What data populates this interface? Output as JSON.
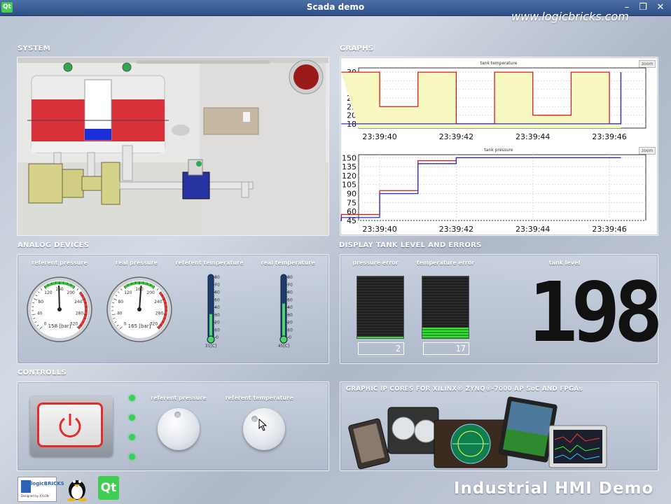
{
  "window": {
    "title": "Scada demo",
    "minimize_glyph": "–",
    "maximize_glyph": "❐",
    "close_glyph": "✕",
    "app_icon_label": "Qt"
  },
  "watermark": "www.logicbricks.com",
  "sections": {
    "system": "SYSTEM",
    "graphs": "GRAPHS",
    "analog": "ANALOG DEVICES",
    "display": "DISPLAY TANK LEVEL AND ERRORS",
    "controls": "CONTROLLS",
    "promo": "GRAPHIC IP CORES FOR XILINX® ZYNQ®-7000 AP SoC AND FPGAs"
  },
  "graphs": {
    "zoom_label": "zoom",
    "temperature": {
      "title": "tank temperature",
      "yticks": [
        "30",
        "28",
        "26",
        "24",
        "22",
        "20",
        "18"
      ],
      "xticks": [
        "23:39:40",
        "23:39:42",
        "23:39:44",
        "23:39:46"
      ]
    },
    "pressure": {
      "title": "tank pressure",
      "yticks": [
        "150",
        "135",
        "120",
        "105",
        "90",
        "75",
        "60",
        "45"
      ],
      "xticks": [
        "23:39:40",
        "23:39:42",
        "23:39:44",
        "23:39:46"
      ]
    }
  },
  "chart_data": [
    {
      "type": "line",
      "title": "tank temperature",
      "ylim": [
        17,
        31
      ],
      "x": [
        "23:39:39",
        "23:39:40",
        "23:39:41",
        "23:39:42",
        "23:39:43",
        "23:39:44",
        "23:39:45",
        "23:39:46",
        "23:39:46.3"
      ],
      "series": [
        {
          "values": [
            30,
            22,
            30,
            18,
            30,
            20,
            30,
            18,
            30
          ],
          "color": "#d02020"
        },
        {
          "values": [
            18,
            18,
            18,
            18,
            18,
            18,
            18,
            18,
            30
          ],
          "color": "#3030c0"
        }
      ],
      "fill_color": "#f7f7c0"
    },
    {
      "type": "line",
      "title": "tank pressure",
      "ylim": [
        45,
        155
      ],
      "x": [
        "23:39:38.6",
        "23:39:39",
        "23:39:40",
        "23:39:41",
        "23:39:42",
        "23:39:43",
        "23:39:44",
        "23:39:45",
        "23:39:46.3"
      ],
      "series": [
        {
          "values": [
            45,
            55,
            95,
            145,
            150,
            150,
            150,
            150,
            150
          ],
          "color": "#d02020"
        },
        {
          "values": [
            45,
            50,
            90,
            140,
            150,
            150,
            150,
            150,
            150
          ],
          "color": "#3030c0"
        }
      ]
    }
  ],
  "analog": {
    "referent_pressure": {
      "label": "referent pressure",
      "value": 158,
      "readout": "158 [bar]"
    },
    "real_pressure": {
      "label": "real pressure",
      "value": 165,
      "readout": "165 [bar]"
    },
    "referent_temperature": {
      "label": "referent  temperature",
      "value": 31,
      "readout": "31[C]"
    },
    "real_temperature": {
      "label": "real temperature",
      "value": 45,
      "readout": "45[C]"
    },
    "gauge_ticks": [
      "0",
      "40",
      "80",
      "120",
      "160",
      "200",
      "240",
      "280",
      "320"
    ],
    "thermo_ticks": [
      "80",
      "70",
      "60",
      "50",
      "40",
      "30",
      "20",
      "10",
      "0"
    ]
  },
  "display": {
    "pressure_error": {
      "label": "pressure error",
      "value": "2",
      "level": 0.02
    },
    "temperature_error": {
      "label": "temperature error",
      "value": "17",
      "level": 0.17
    },
    "tank_level": {
      "label": "tank level",
      "value": "198"
    }
  },
  "controls": {
    "power_icon": "power-icon",
    "referent_pressure_label": "referent pressure",
    "referent_temperature_label": "referent temperature"
  },
  "footer": {
    "brand_logo": "logicBRICKS",
    "brand_sub": "Designed by XYLON",
    "linux_icon": "tux-icon",
    "qt_logo": "Qt",
    "title": "Industrial HMI Demo"
  },
  "colors": {
    "tank_red": "#d9303a",
    "accent_green": "#39d05a",
    "title_bar": "#3a5b94"
  }
}
